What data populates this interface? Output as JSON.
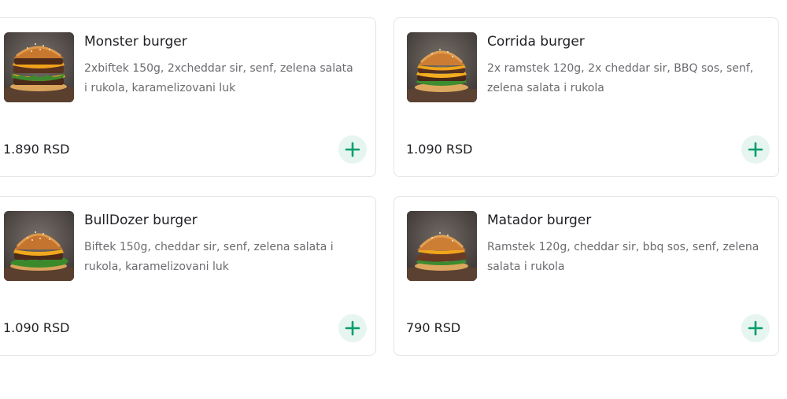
{
  "menu": {
    "items": [
      {
        "title": "Monster burger",
        "description": "2xbiftek 150g, 2xcheddar sir, senf, zelena salata i rukola, karamelizovani luk",
        "price": "1.890 RSD",
        "image_icon": "burger-photo"
      },
      {
        "title": "Corrida burger",
        "description": "2x ramstek 120g, 2x cheddar sir, BBQ sos, senf, zelena salata i rukola",
        "price": "1.090 RSD",
        "image_icon": "burger-photo"
      },
      {
        "title": "BullDozer burger",
        "description": "Biftek 150g, cheddar sir, senf, zelena salata i rukola, karamelizovani luk",
        "price": "1.090 RSD",
        "image_icon": "burger-photo"
      },
      {
        "title": "Matador burger",
        "description": "Ramstek 120g, cheddar sir, bbq sos, senf, zelena salata i rukola",
        "price": "790 RSD",
        "image_icon": "burger-photo"
      }
    ],
    "add_icon": "plus-icon"
  },
  "colors": {
    "text": "#202125",
    "description": "#6b6b70",
    "card_border": "#e4e4e4",
    "add_button_bg": "#e7f5f0",
    "add_button_icon": "#009e6b"
  }
}
